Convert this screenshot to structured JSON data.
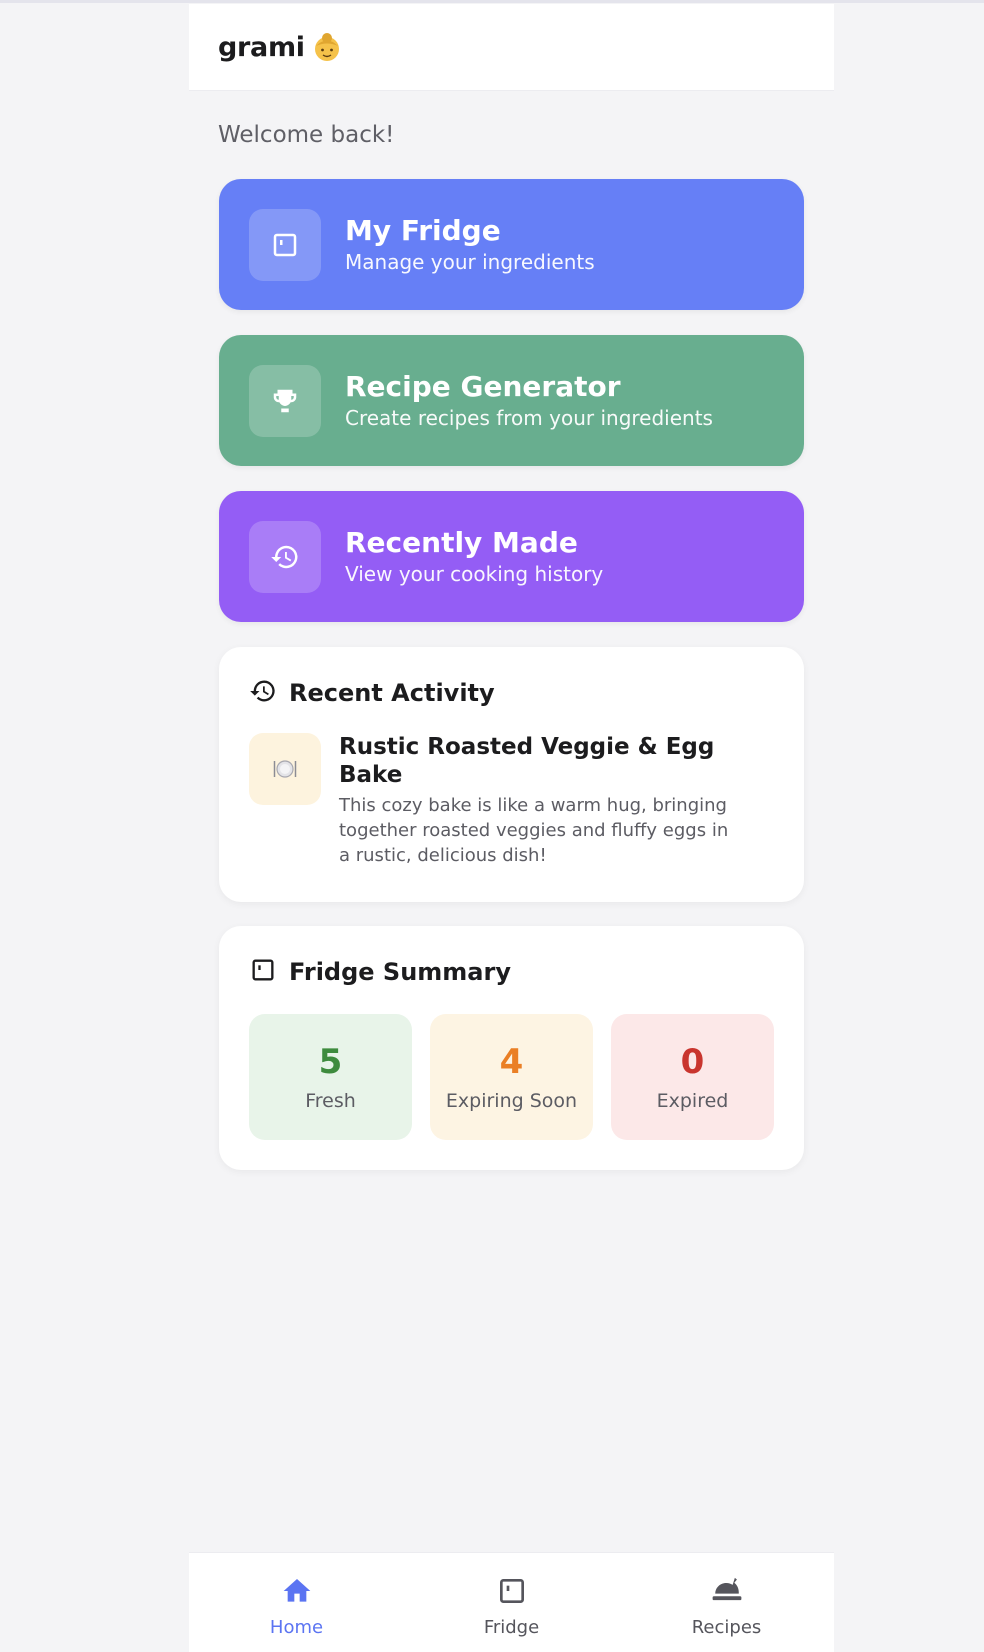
{
  "header": {
    "brand": "grami",
    "brand_icon": "grandmother-emoji-icon"
  },
  "welcome": "Welcome back!",
  "feature_cards": [
    {
      "title": "My Fridge",
      "subtitle": "Manage your ingredients",
      "icon": "fridge-icon",
      "color": "#667ff6"
    },
    {
      "title": "Recipe Generator",
      "subtitle": "Create recipes from your ingredients",
      "icon": "trophy-icon",
      "color": "#68ae8f"
    },
    {
      "title": "Recently Made",
      "subtitle": "View your cooking history",
      "icon": "history-icon",
      "color": "#945df5"
    }
  ],
  "recent_activity": {
    "title": "Recent Activity",
    "icon": "history-icon",
    "item": {
      "title": "Rustic Roasted Veggie & Egg Bake",
      "description": "This cozy bake is like a warm hug, bringing together roasted veggies and fluffy eggs in a rustic, delicious dish!",
      "icon": "plate-icon"
    }
  },
  "fridge_summary": {
    "title": "Fridge Summary",
    "icon": "fridge-icon",
    "stats": [
      {
        "value": "5",
        "label": "Fresh",
        "color": "#3e8b3e"
      },
      {
        "value": "4",
        "label": "Expiring Soon",
        "color": "#ea7f25"
      },
      {
        "value": "0",
        "label": "Expired",
        "color": "#c9352e"
      }
    ]
  },
  "bottom_nav": [
    {
      "label": "Home",
      "icon": "home-icon",
      "active": true
    },
    {
      "label": "Fridge",
      "icon": "fridge-icon",
      "active": false
    },
    {
      "label": "Recipes",
      "icon": "cloche-icon",
      "active": false
    }
  ],
  "colors": {
    "accent": "#5b74f2",
    "background": "#f4f4f6"
  }
}
